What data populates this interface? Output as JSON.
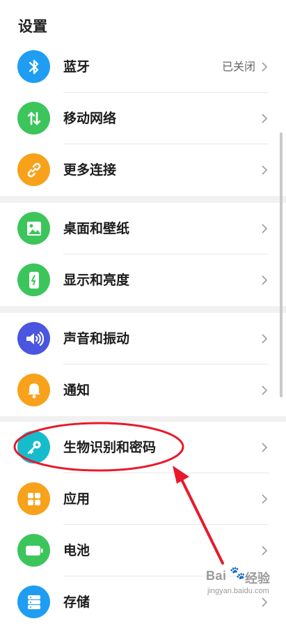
{
  "title": "设置",
  "rows": [
    {
      "label": "蓝牙",
      "value": "已关闭",
      "icon": "bluetooth-icon",
      "color": "#1e9df2"
    },
    {
      "label": "移动网络",
      "value": "",
      "icon": "mobile-data-icon",
      "color": "#3cc55b"
    },
    {
      "label": "更多连接",
      "value": "",
      "icon": "link-icon",
      "color": "#f7a21a"
    },
    {
      "label": "桌面和壁纸",
      "value": "",
      "icon": "wallpaper-icon",
      "color": "#3cc55b"
    },
    {
      "label": "显示和亮度",
      "value": "",
      "icon": "display-brightness-icon",
      "color": "#3cc55b"
    },
    {
      "label": "声音和振动",
      "value": "",
      "icon": "sound-icon",
      "color": "#4a56e0"
    },
    {
      "label": "通知",
      "value": "",
      "icon": "notification-bell-icon",
      "color": "#f7a21a"
    },
    {
      "label": "生物识别和密码",
      "value": "",
      "icon": "key-icon",
      "color": "#16bccc"
    },
    {
      "label": "应用",
      "value": "",
      "icon": "apps-grid-icon",
      "color": "#f7a21a"
    },
    {
      "label": "电池",
      "value": "",
      "icon": "battery-icon",
      "color": "#3cc55b"
    },
    {
      "label": "存储",
      "value": "",
      "icon": "storage-icon",
      "color": "#1e9df2"
    }
  ],
  "annotation": {
    "color": "#e8192c"
  },
  "watermark": {
    "brand": "Bai",
    "brand2": "经验",
    "url": "jingyan.baidu.com"
  }
}
